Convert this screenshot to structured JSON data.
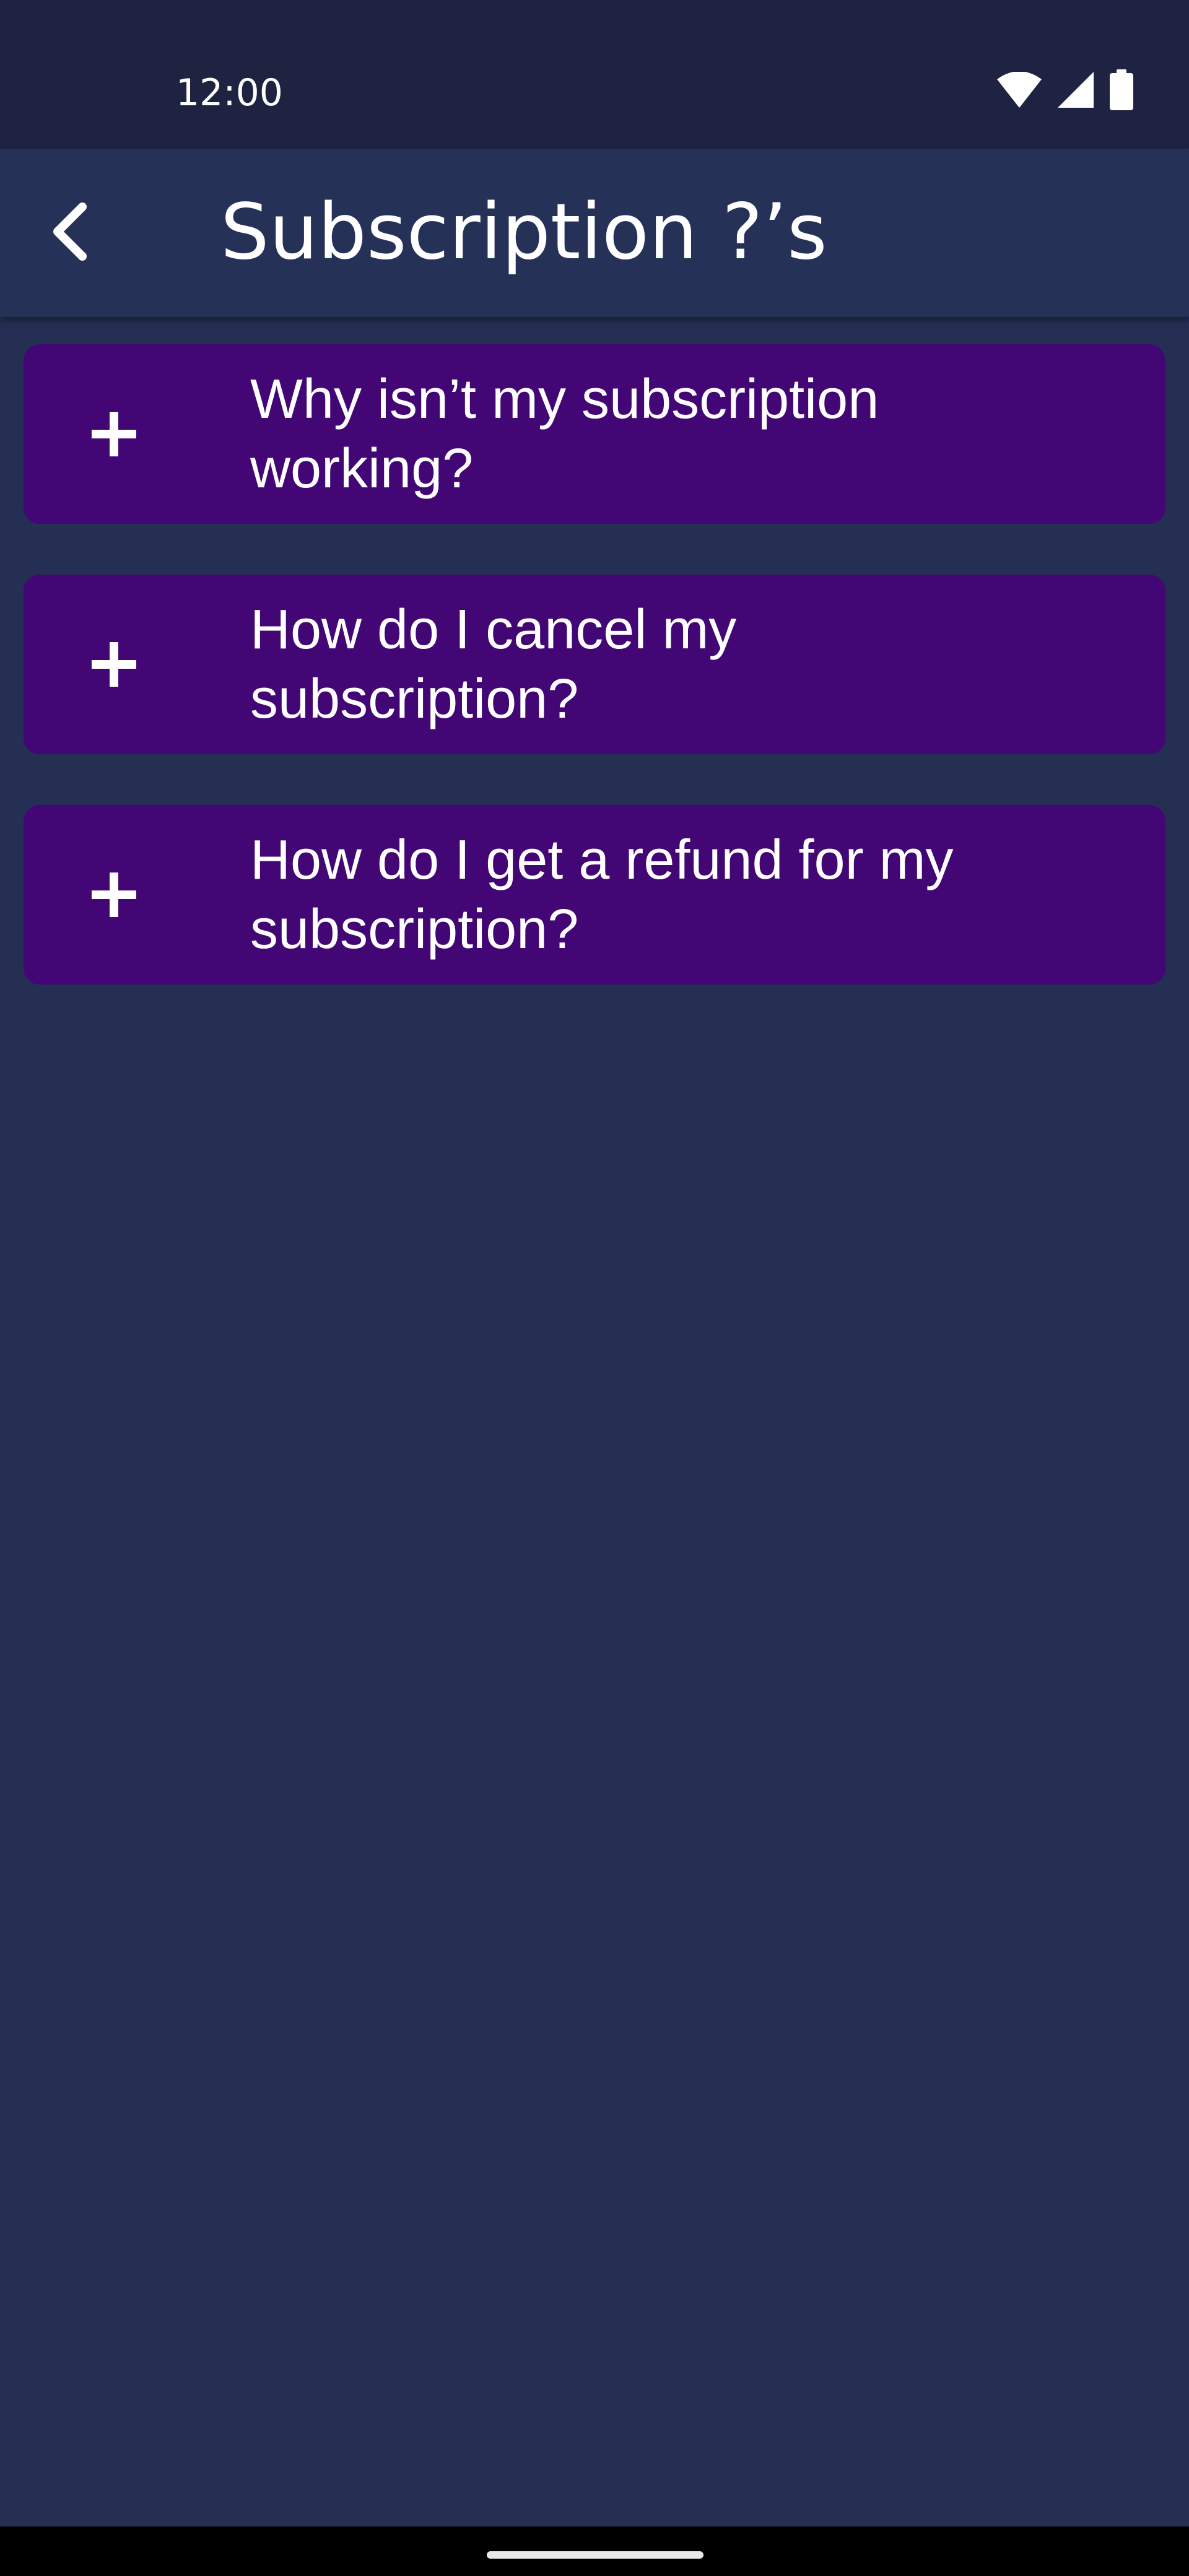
{
  "status_bar": {
    "time": "12:00",
    "icons": [
      "wifi-icon",
      "cellular-signal-icon",
      "battery-icon"
    ]
  },
  "app_bar": {
    "back_icon": "chevron-left-icon",
    "title": "Subscription ?’s"
  },
  "faq": {
    "expand_icon": "plus-icon",
    "items": [
      {
        "question": "Why isn’t my subscription working?"
      },
      {
        "question": "How do I cancel my subscription?"
      },
      {
        "question": "How do I get a refund for my subscription?"
      }
    ]
  },
  "colors": {
    "background": "#252f53",
    "status_bar": "#1d2340",
    "app_bar": "#263158",
    "card": "#430675",
    "text": "#ffffff"
  }
}
